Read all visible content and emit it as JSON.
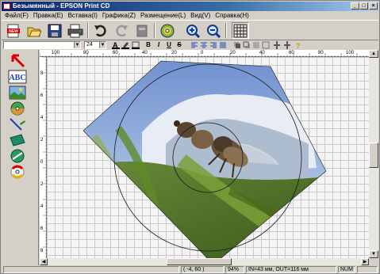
{
  "window": {
    "title": "Безымянный - EPSON Print CD"
  },
  "title_buttons": {
    "minimize": "_",
    "maximize": "□",
    "close": "×"
  },
  "menu": [
    {
      "label": "Файл(F)"
    },
    {
      "label": "Правка(E)"
    },
    {
      "label": "Вставка(I)"
    },
    {
      "label": "Графика(Z)"
    },
    {
      "label": "Размещение(L)"
    },
    {
      "label": "Вид(V)"
    },
    {
      "label": "Справка(H)"
    }
  ],
  "toolbar": {
    "new_label": "NEW",
    "icons": [
      "new-icon",
      "open-icon",
      "save-icon",
      "print-icon",
      "undo-icon",
      "redo-icon",
      "layout-icon",
      "cd-icon",
      "zoom-in-icon",
      "zoom-out-icon",
      "grid-icon"
    ]
  },
  "formatbar": {
    "font_value": "",
    "size_value": "24",
    "bold": "B",
    "italic": "I",
    "underline": "U",
    "strike": "S"
  },
  "palette": {
    "text_tool_label": "ABC"
  },
  "ruler": {
    "h_labels": [
      "100",
      "80",
      "60",
      "40",
      "20",
      "0",
      "20",
      "40",
      "60",
      "80",
      "100"
    ],
    "v_labels": [
      "8",
      "6",
      "4",
      "2",
      "0",
      "2",
      "4",
      "6",
      "8"
    ]
  },
  "status": {
    "coords": "( -4, 60 )",
    "zoom": "94%",
    "diam": "IN=43 мм, OUT=116 мм",
    "num": "NUM"
  },
  "colors": {
    "title_start": "#0a246a",
    "title_end": "#a6caf0",
    "accent_red": "#cc0000"
  }
}
